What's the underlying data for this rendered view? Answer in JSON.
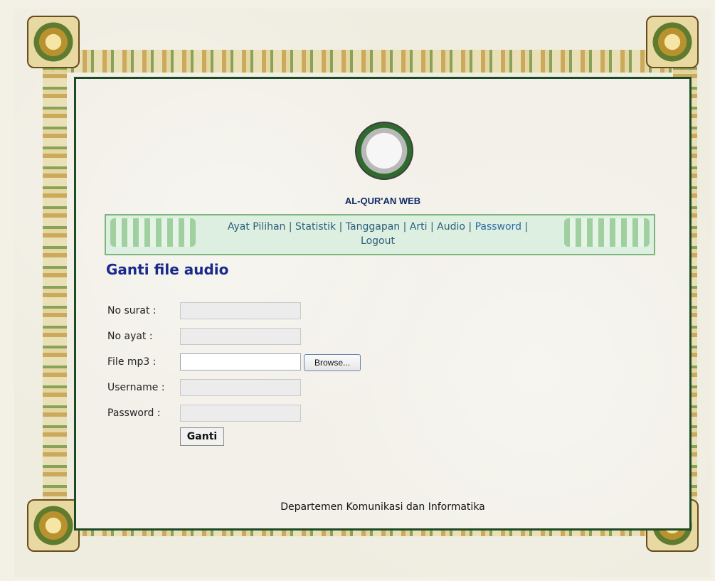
{
  "site": {
    "logo_title": "AL-QUR'AN WEB"
  },
  "nav": {
    "items": [
      {
        "label": "Ayat Pilihan"
      },
      {
        "label": "Statistik"
      },
      {
        "label": "Tanggapan"
      },
      {
        "label": "Arti"
      },
      {
        "label": "Audio"
      },
      {
        "label": "Password"
      },
      {
        "label": "Logout"
      }
    ],
    "separator": " | "
  },
  "page": {
    "title": "Ganti file audio"
  },
  "form": {
    "fields": {
      "no_surat": {
        "label": "No surat :",
        "value": ""
      },
      "no_ayat": {
        "label": "No ayat :",
        "value": ""
      },
      "file_mp3": {
        "label": "File mp3 :",
        "value": ""
      },
      "username": {
        "label": "Username :",
        "value": ""
      },
      "password": {
        "label": "Password :",
        "value": ""
      }
    },
    "browse_label": "Browse...",
    "submit_label": "Ganti"
  },
  "footer": {
    "text": "Departemen Komunikasi dan Informatika"
  },
  "icons": {
    "logo": "quran-emblem-icon",
    "nav_left_ornament": "ornament-icon",
    "nav_right_ornament": "ornament-icon"
  },
  "colors": {
    "heading": "#1a2a8a",
    "nav_link": "#2f5f7a",
    "nav_password": "#2e6aa3",
    "frame_border": "#1d4a26"
  }
}
